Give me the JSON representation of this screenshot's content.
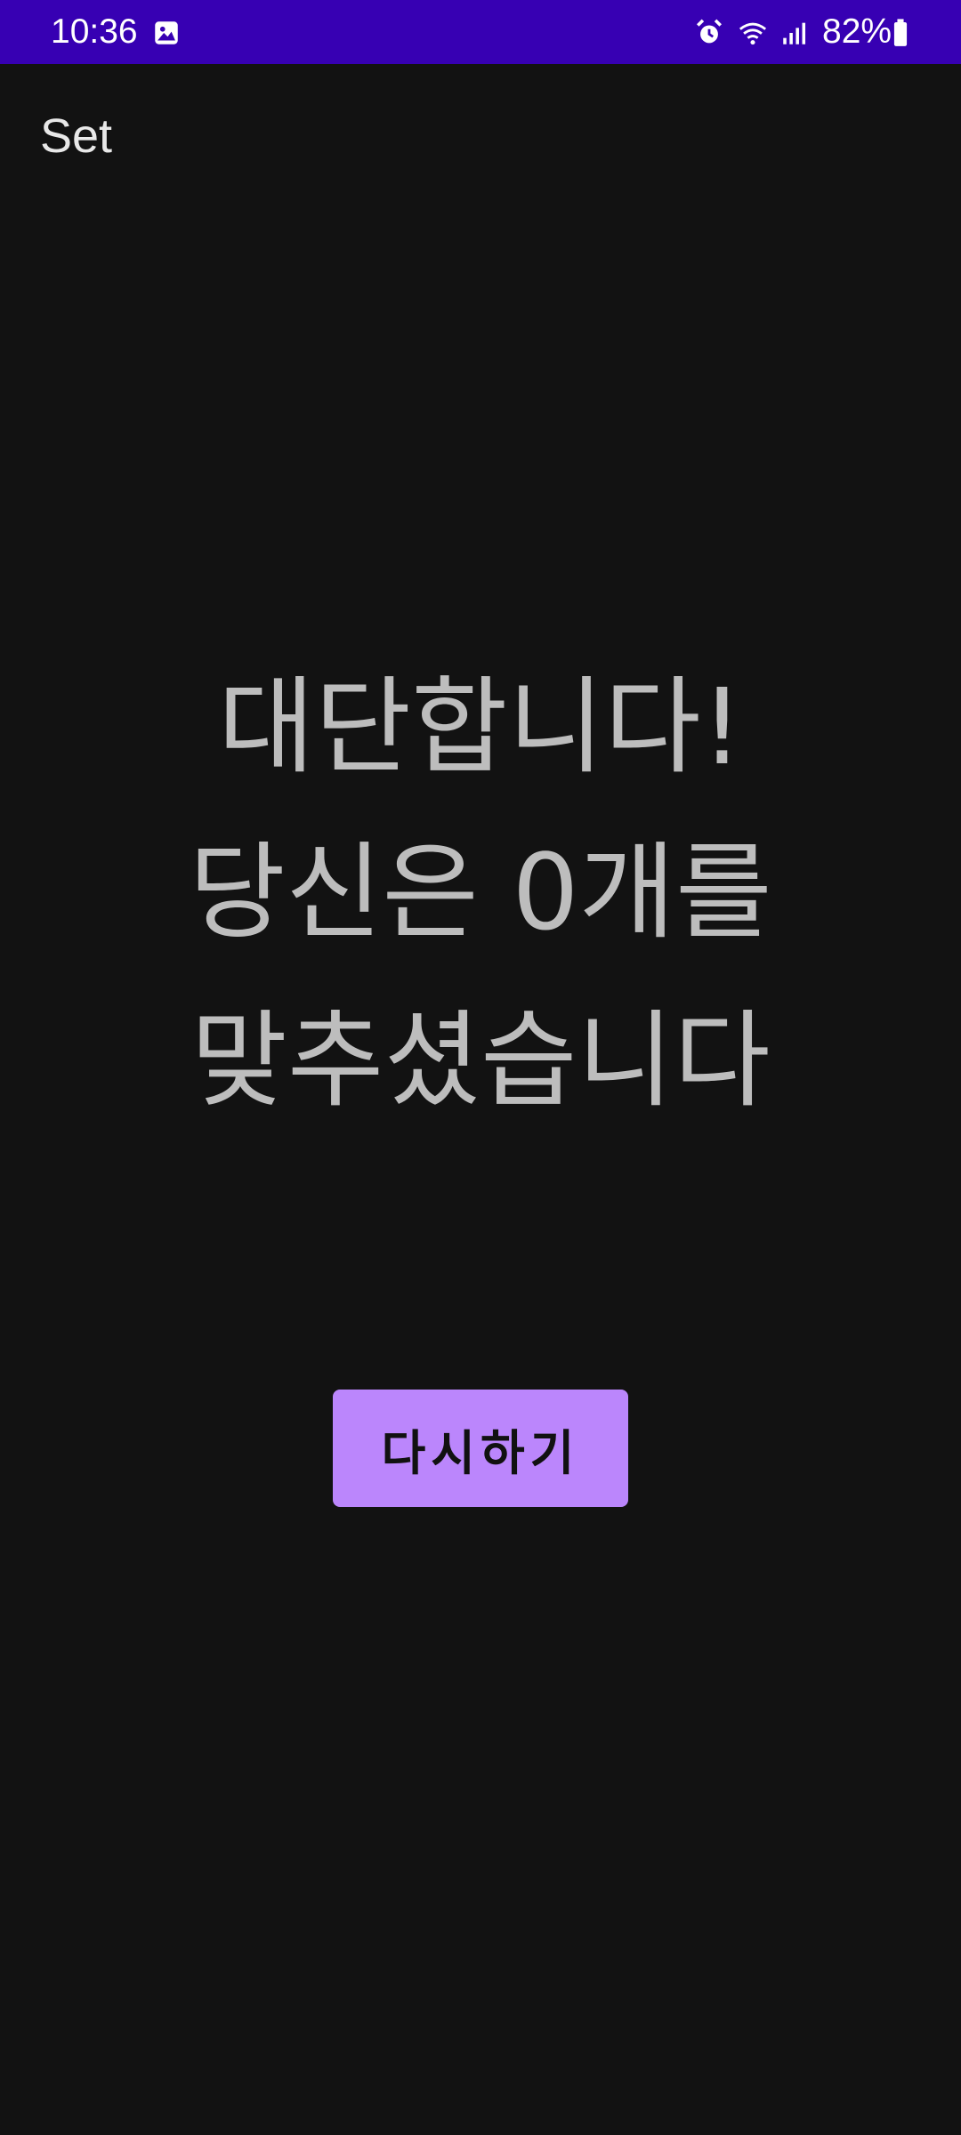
{
  "status_bar": {
    "time": "10:36",
    "battery": "82%",
    "icons": [
      "image-icon",
      "alarm-icon",
      "wifi-icon",
      "signal-icon",
      "battery-icon"
    ],
    "background": "#3700b3"
  },
  "app_bar": {
    "title": "Set"
  },
  "result": {
    "line1": "대단합니다!",
    "line2": "당신은 0개를",
    "line3": "맞추셨습니다"
  },
  "retry_button": {
    "label": "다시하기",
    "color": "#bb86fc"
  },
  "theme": {
    "background": "#121212",
    "text": "#bdbdbd"
  }
}
